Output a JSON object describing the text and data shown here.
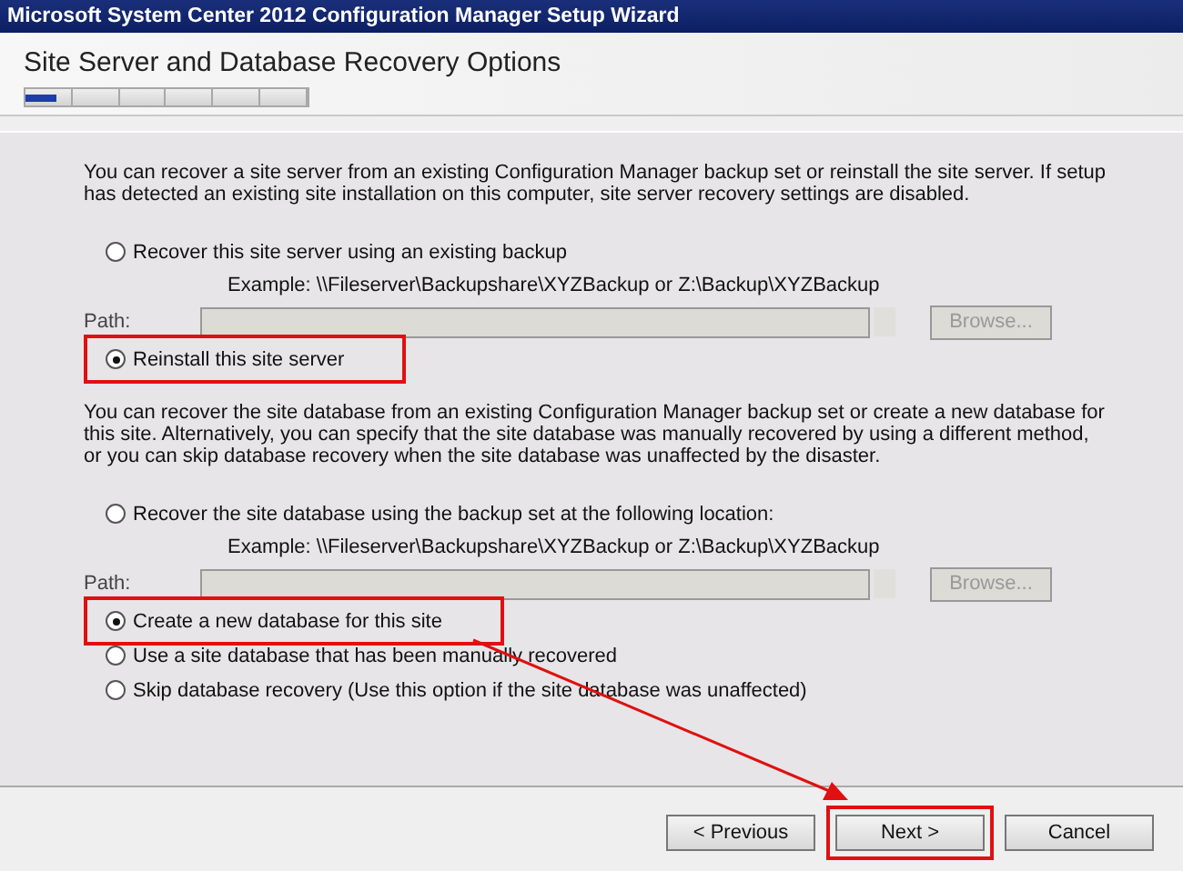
{
  "window": {
    "title": "Microsoft System Center 2012 Configuration Manager Setup Wizard"
  },
  "header": {
    "title": "Site Server and Database Recovery Options",
    "steps": [
      {
        "selected": true
      },
      {
        "selected": false
      },
      {
        "selected": false
      },
      {
        "selected": false
      },
      {
        "selected": false
      },
      {
        "selected": false
      }
    ]
  },
  "sections": [
    {
      "description": "You can recover a site server from an existing Configuration Manager backup set or reinstall the site server. If setup has detected an existing site installation on this computer, site server recovery settings are disabled.",
      "items": [
        {
          "kind": "radio",
          "label": "Recover this site server using an existing backup",
          "selected": false,
          "highlighted": false
        },
        {
          "kind": "example",
          "text": "Example: \\\\Fileserver\\Backupshare\\XYZBackup or Z:\\Backup\\XYZBackup"
        },
        {
          "kind": "path",
          "label": "Path:",
          "button": "Browse...",
          "disabled": true
        },
        {
          "kind": "radio",
          "label": "Reinstall this site server",
          "selected": true,
          "highlighted": true
        }
      ]
    },
    {
      "description": "You can recover the site database from an existing Configuration Manager backup set or create a new database for this site. Alternatively, you can specify that the site database was manually recovered by using a different method, or you can skip database recovery when the site database was unaffected by the disaster.",
      "items": [
        {
          "kind": "radio",
          "label": "Recover the site database using the backup set at the following location:",
          "selected": false,
          "highlighted": false
        },
        {
          "kind": "example",
          "text": "Example: \\\\Fileserver\\Backupshare\\XYZBackup or Z:\\Backup\\XYZBackup"
        },
        {
          "kind": "path",
          "label": "Path:",
          "button": "Browse...",
          "disabled": true
        },
        {
          "kind": "radio",
          "label": "Create a new database for this site",
          "selected": true,
          "highlighted": true
        },
        {
          "kind": "radio",
          "label": "Use a site database that has been manually recovered",
          "selected": false,
          "highlighted": false
        },
        {
          "kind": "radio",
          "label": "Skip database recovery (Use this option if the site database was unaffected)",
          "selected": false,
          "highlighted": false
        }
      ]
    }
  ],
  "buttons": [
    {
      "label": "< Previous",
      "highlighted": false
    },
    {
      "label": "Next >",
      "highlighted": true
    },
    {
      "label": "Cancel",
      "highlighted": false
    }
  ]
}
